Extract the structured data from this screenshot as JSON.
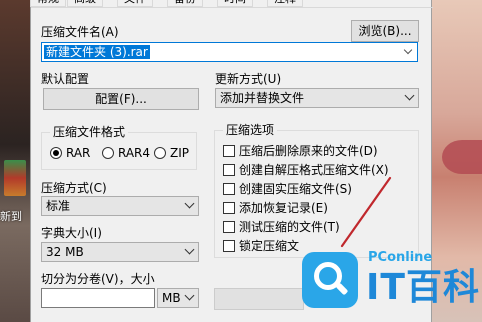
{
  "desktop": {
    "icon_label": "新到"
  },
  "tabs": [
    "常规",
    "高级",
    "文件",
    "备份",
    "时间",
    "注释"
  ],
  "archive_name": {
    "label": "压缩文件名(A)",
    "value": "新建文件夹 (3).rar",
    "browse_label": "浏览(B)..."
  },
  "profiles": {
    "label": "默认配置",
    "button_label": "配置(F)..."
  },
  "update_mode": {
    "label": "更新方式(U)",
    "value": "添加并替换文件"
  },
  "archive_format": {
    "title": "压缩文件格式",
    "options": [
      "RAR",
      "RAR4",
      "ZIP"
    ],
    "selected": "RAR"
  },
  "compression_method": {
    "label": "压缩方式(C)",
    "value": "标准"
  },
  "dictionary_size": {
    "label": "字典大小(I)",
    "value": "32 MB"
  },
  "split_volumes": {
    "label": "切分为分卷(V)，大小",
    "unit": "MB"
  },
  "archiving_options": {
    "title": "压缩选项",
    "items": [
      "压缩后删除原来的文件(D)",
      "创建自解压格式压缩文件(X)",
      "创建固实压缩文件(S)",
      "添加恢复记录(E)",
      "测试压缩的文件(T)",
      "锁定压缩文"
    ]
  },
  "watermark": {
    "brand": "PConline",
    "text": "IT百科"
  }
}
